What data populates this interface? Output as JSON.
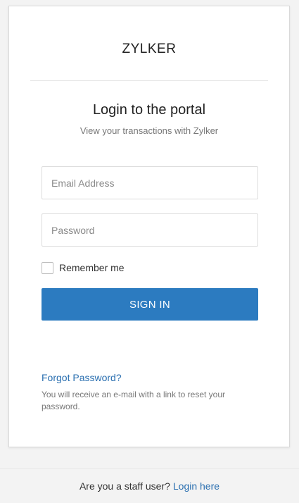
{
  "brand": {
    "name": "ZYLKER"
  },
  "login": {
    "title": "Login to the portal",
    "subtitle": "View your transactions with Zylker",
    "email_placeholder": "Email Address",
    "email_value": "",
    "password_placeholder": "Password",
    "password_value": "",
    "remember_label": "Remember me",
    "remember_checked": false,
    "signin_label": "SIGN IN",
    "forgot_label": "Forgot Password?",
    "forgot_note": "You will receive an e-mail with a link to reset your password."
  },
  "footer": {
    "prompt": "Are you a staff user?",
    "link_label": "Login here"
  },
  "colors": {
    "accent": "#2c7bc0",
    "link": "#2a6fb0",
    "page_bg": "#f3f3f3"
  }
}
